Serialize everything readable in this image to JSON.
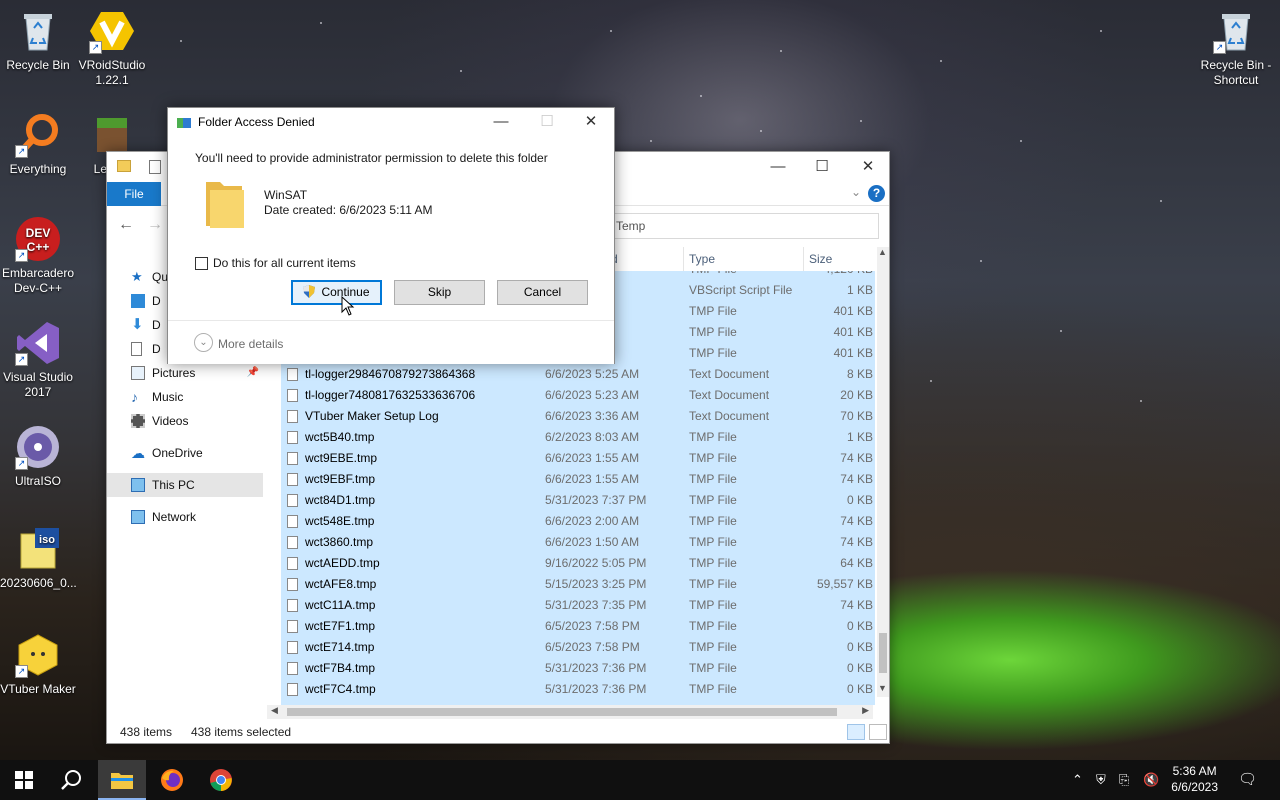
{
  "desktop": {
    "icons": [
      {
        "label": "Recycle Bin"
      },
      {
        "label": "VRoidStudio 1.22.1"
      },
      {
        "label": "Everything"
      },
      {
        "label": "Le Lau"
      },
      {
        "label": "Embarcadero Dev-C++"
      },
      {
        "label": "Visual Studio 2017"
      },
      {
        "label": "UltraISO"
      },
      {
        "label": "20230606_0..."
      },
      {
        "label": "VTuber Maker"
      },
      {
        "label": "Recycle Bin - Shortcut"
      }
    ]
  },
  "explorer": {
    "file_tab": "File",
    "address_tail": "Temp",
    "help_glyph": "?",
    "nav": {
      "quick_access_partial": "Qu",
      "desktop_partial": "D",
      "downloads_partial": "D",
      "documents_partial": "D",
      "pictures": "Pictures",
      "music": "Music",
      "videos": "Videos",
      "onedrive": "OneDrive",
      "this_pc": "This PC",
      "network": "Network"
    },
    "columns": {
      "name_partial": "d",
      "type": "Type",
      "size": "Size"
    },
    "rows": [
      {
        "name": "",
        "date": "",
        "type": "TMP File",
        "size": "4,120 KB"
      },
      {
        "name": "",
        "date": "5 PM",
        "type": "VBScript Script File",
        "size": "1 KB"
      },
      {
        "name": "",
        "date": "AM",
        "type": "TMP File",
        "size": "401 KB"
      },
      {
        "name": "",
        "date": "AM",
        "type": "TMP File",
        "size": "401 KB"
      },
      {
        "name": "",
        "date": "AM",
        "type": "TMP File",
        "size": "401 KB"
      },
      {
        "name": "tl-logger2984670879273864368",
        "date": "6/6/2023 5:25 AM",
        "type": "Text Document",
        "size": "8 KB"
      },
      {
        "name": "tl-logger7480817632533636706",
        "date": "6/6/2023 5:23 AM",
        "type": "Text Document",
        "size": "20 KB"
      },
      {
        "name": "VTuber Maker Setup Log",
        "date": "6/6/2023 3:36 AM",
        "type": "Text Document",
        "size": "70 KB"
      },
      {
        "name": "wct5B40.tmp",
        "date": "6/2/2023 8:03 AM",
        "type": "TMP File",
        "size": "1 KB"
      },
      {
        "name": "wct9EBE.tmp",
        "date": "6/6/2023 1:55 AM",
        "type": "TMP File",
        "size": "74 KB"
      },
      {
        "name": "wct9EBF.tmp",
        "date": "6/6/2023 1:55 AM",
        "type": "TMP File",
        "size": "74 KB"
      },
      {
        "name": "wct84D1.tmp",
        "date": "5/31/2023 7:37 PM",
        "type": "TMP File",
        "size": "0 KB"
      },
      {
        "name": "wct548E.tmp",
        "date": "6/6/2023 2:00 AM",
        "type": "TMP File",
        "size": "74 KB"
      },
      {
        "name": "wct3860.tmp",
        "date": "6/6/2023 1:50 AM",
        "type": "TMP File",
        "size": "74 KB"
      },
      {
        "name": "wctAEDD.tmp",
        "date": "9/16/2022 5:05 PM",
        "type": "TMP File",
        "size": "64 KB"
      },
      {
        "name": "wctAFE8.tmp",
        "date": "5/15/2023 3:25 PM",
        "type": "TMP File",
        "size": "59,557 KB"
      },
      {
        "name": "wctC11A.tmp",
        "date": "5/31/2023 7:35 PM",
        "type": "TMP File",
        "size": "74 KB"
      },
      {
        "name": "wctE7F1.tmp",
        "date": "6/5/2023 7:58 PM",
        "type": "TMP File",
        "size": "0 KB"
      },
      {
        "name": "wctE714.tmp",
        "date": "6/5/2023 7:58 PM",
        "type": "TMP File",
        "size": "0 KB"
      },
      {
        "name": "wctF7B4.tmp",
        "date": "5/31/2023 7:36 PM",
        "type": "TMP File",
        "size": "0 KB"
      },
      {
        "name": "wctF7C4.tmp",
        "date": "5/31/2023 7:36 PM",
        "type": "TMP File",
        "size": "0 KB"
      }
    ],
    "status": {
      "items": "438 items",
      "selected": "438 items selected"
    }
  },
  "dialog": {
    "title": "Folder Access Denied",
    "message": "You'll need to provide administrator permission to delete this folder",
    "folder_name": "WinSAT",
    "folder_date": "Date created: 6/6/2023 5:11 AM",
    "checkbox_label": "Do this for all current items",
    "buttons": {
      "continue": "Continue",
      "skip": "Skip",
      "cancel": "Cancel"
    },
    "more_details": "More details",
    "controls": {
      "minimize": "—",
      "maximize": "☐",
      "close": "✕"
    }
  },
  "taskbar": {
    "time": "5:36 AM",
    "date": "6/6/2023"
  },
  "colors": {
    "accent": "#0078d7",
    "selection": "#cce8ff",
    "file_tab": "#1979ca",
    "taskbar": "#101010"
  }
}
